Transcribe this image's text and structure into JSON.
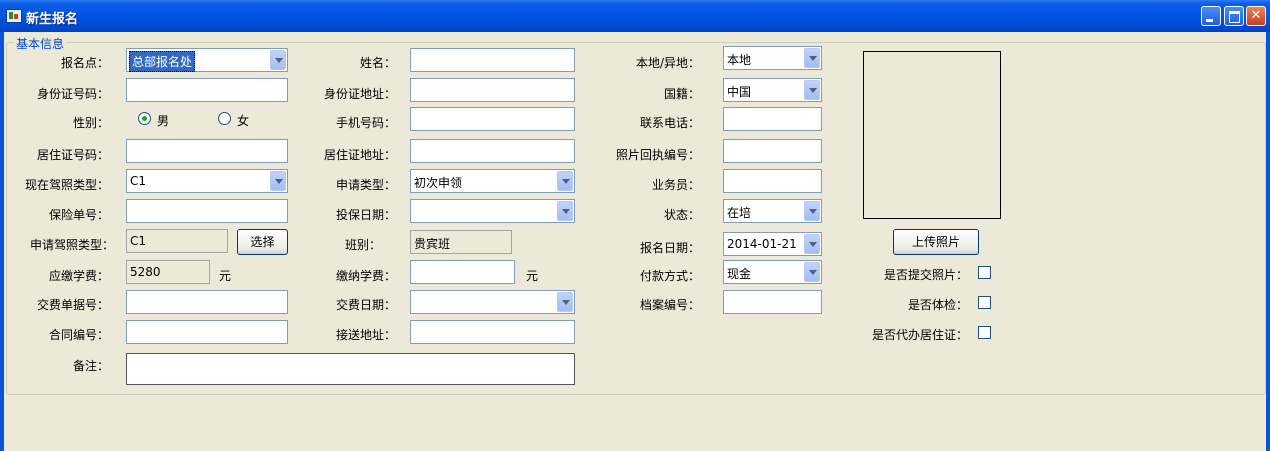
{
  "window": {
    "title": "新生报名"
  },
  "group": {
    "title": "基本信息"
  },
  "labels": {
    "signup_point": "报名点：",
    "id_number": "身份证号码：",
    "gender": "性别：",
    "residence_permit_no": "居住证号码：",
    "current_license_type": "现在驾照类型：",
    "insurance_no": "保险单号：",
    "apply_license_type": "申请驾照类型：",
    "tuition_due": "应缴学费：",
    "receipt_no": "交费单据号：",
    "contract_no": "合同编号：",
    "remarks": "备注：",
    "name": "姓名：",
    "id_address": "身份证地址：",
    "mobile": "手机号码：",
    "residence_address": "居住证地址：",
    "apply_type": "申请类型：",
    "insure_date": "投保日期：",
    "class": "班别：",
    "tuition_paid": "缴纳学费：",
    "payment_date": "交费日期：",
    "pickup_address": "接送地址：",
    "local_nonlocal": "本地/异地：",
    "nationality": "国籍：",
    "contact_phone": "联系电话：",
    "photo_receipt_no": "照片回执编号：",
    "salesperson": "业务员：",
    "status": "状态：",
    "signup_date": "报名日期：",
    "payment_method": "付款方式：",
    "file_no": "档案编号：",
    "photo_submitted": "是否提交照片：",
    "medical_check": "是否体检：",
    "residence_agent": "是否代办居住证："
  },
  "values": {
    "signup_point": "总部报名处",
    "gender_male": "男",
    "gender_female": "女",
    "current_license_type": "C1",
    "apply_license_type": "C1",
    "tuition_due": "5280",
    "unit_yuan": "元",
    "apply_type": "初次申领",
    "class": "贵宾班",
    "local_nonlocal": "本地",
    "nationality": "中国",
    "status": "在培",
    "signup_date": "2014-01-21",
    "payment_method": "现金"
  },
  "buttons": {
    "select": "选择",
    "upload_photo": "上传照片"
  }
}
